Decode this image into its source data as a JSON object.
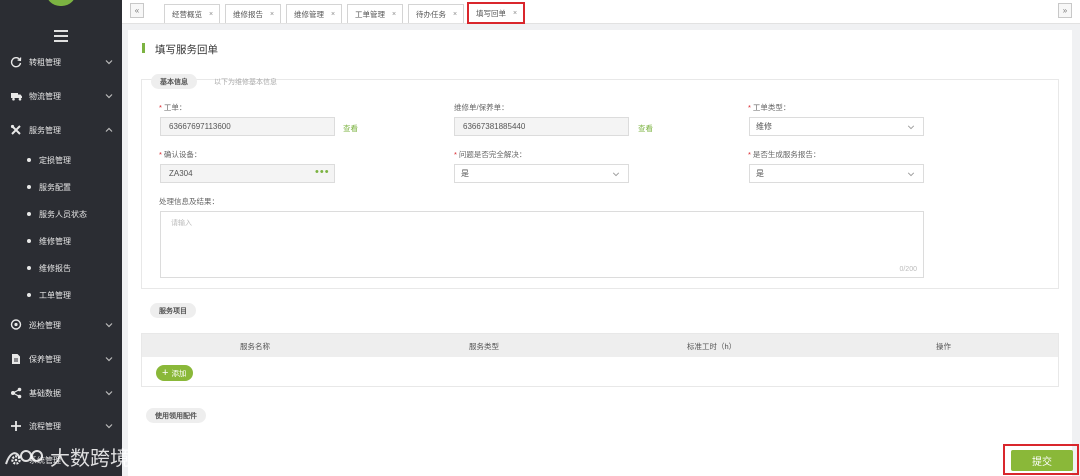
{
  "sidebar": {
    "menu": [
      {
        "label": "转租管理",
        "icon": "refresh-icon"
      },
      {
        "label": "物流管理",
        "icon": "truck-icon"
      },
      {
        "label": "服务管理",
        "icon": "tools-icon"
      }
    ],
    "service_sub": [
      "定损管理",
      "服务配置",
      "服务人员状态",
      "维修管理",
      "维修报告",
      "工单管理"
    ],
    "menu2": [
      {
        "label": "巡检管理",
        "icon": "location-icon"
      },
      {
        "label": "保养管理",
        "icon": "document-icon"
      },
      {
        "label": "基础数据",
        "icon": "share-icon"
      },
      {
        "label": "流程管理",
        "icon": "plus-icon"
      },
      {
        "label": "系统管理",
        "icon": "gear-icon"
      }
    ]
  },
  "tabs": [
    {
      "label": "经营概览",
      "close": "×"
    },
    {
      "label": "维修报告",
      "close": "×"
    },
    {
      "label": "维修管理",
      "close": "×"
    },
    {
      "label": "工单管理",
      "close": "×"
    },
    {
      "label": "待办任务",
      "close": "×"
    },
    {
      "label": "填写回单",
      "close": "×"
    }
  ],
  "nav": {
    "prev": "«",
    "next": "»"
  },
  "page": {
    "title": "填写服务回单",
    "basic": {
      "badge": "基本信息",
      "hint": "以下为维修基本信息",
      "work_order": {
        "label": "工单：",
        "value": "63667697113600",
        "link": "查看"
      },
      "repair_order": {
        "label": "维修单/保养单：",
        "value": "63667381885440",
        "link": "查看"
      },
      "order_type": {
        "label": "工单类型：",
        "value": "维修"
      },
      "device": {
        "label": "确认设备：",
        "value": "ZA304",
        "more": "•••"
      },
      "resolved": {
        "label": "问题是否完全解决：",
        "value": "是"
      },
      "report": {
        "label": "是否生成服务报告：",
        "value": "是"
      },
      "process": {
        "label": "处理信息及结果：",
        "placeholder": "请输入",
        "count": "0/200"
      }
    },
    "service_items": {
      "badge": "服务项目",
      "columns": [
        "服务名称",
        "服务类型",
        "标准工时（h）",
        "操作"
      ],
      "add_label": "添加"
    },
    "parts": {
      "badge": "使用领用配件"
    },
    "submit": "提交"
  },
  "watermark": "大数跨境",
  "colors": {
    "accent": "#8ab839",
    "highlight": "#d9262c",
    "sidebar": "#2b2d33"
  }
}
